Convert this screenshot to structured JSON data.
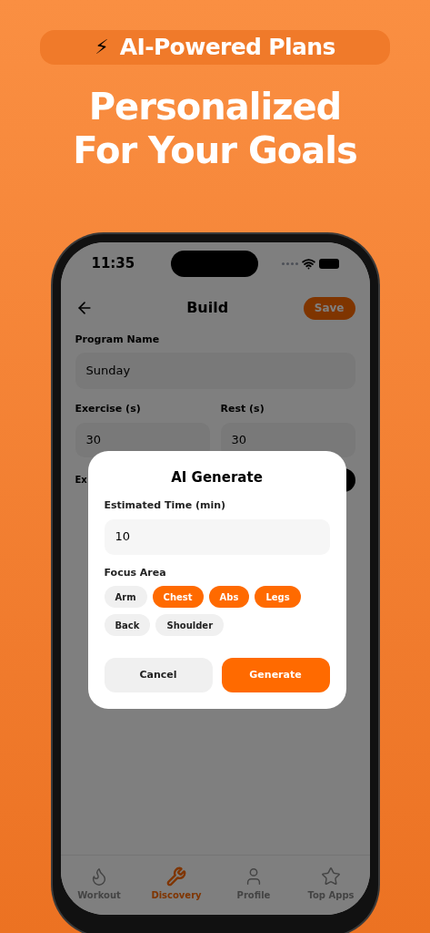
{
  "promo": {
    "badge_icon": "⚡",
    "badge": "AI-Powered Plans",
    "headline": [
      "Personalized",
      "For Your Goals"
    ]
  },
  "status_bar": {
    "time": "11:35"
  },
  "header": {
    "title": "Build",
    "save": "Save"
  },
  "form": {
    "program_name": {
      "label": "Program Name",
      "value": "Sunday"
    },
    "exercise": {
      "label": "Exercise (s)",
      "value": "30"
    },
    "rest": {
      "label": "Rest (s)",
      "value": "30"
    },
    "cut_label": "Ex"
  },
  "dialog": {
    "title": "AI Generate",
    "time_label": "Estimated Time (min)",
    "time_value": "10",
    "focus_label": "Focus Area",
    "chips": [
      {
        "label": "Arm",
        "selected": false
      },
      {
        "label": "Chest",
        "selected": true
      },
      {
        "label": "Abs",
        "selected": true
      },
      {
        "label": "Legs",
        "selected": true
      },
      {
        "label": "Back",
        "selected": false
      },
      {
        "label": "Shoulder",
        "selected": false
      }
    ],
    "cancel": "Cancel",
    "generate": "Generate"
  },
  "tab_bar": [
    {
      "label": "Workout",
      "kind": "flame",
      "selected": false
    },
    {
      "label": "Discovery",
      "kind": "tools",
      "selected": true
    },
    {
      "label": "Profile",
      "kind": "person",
      "selected": false
    },
    {
      "label": "Top Apps",
      "kind": "star",
      "selected": false
    }
  ]
}
